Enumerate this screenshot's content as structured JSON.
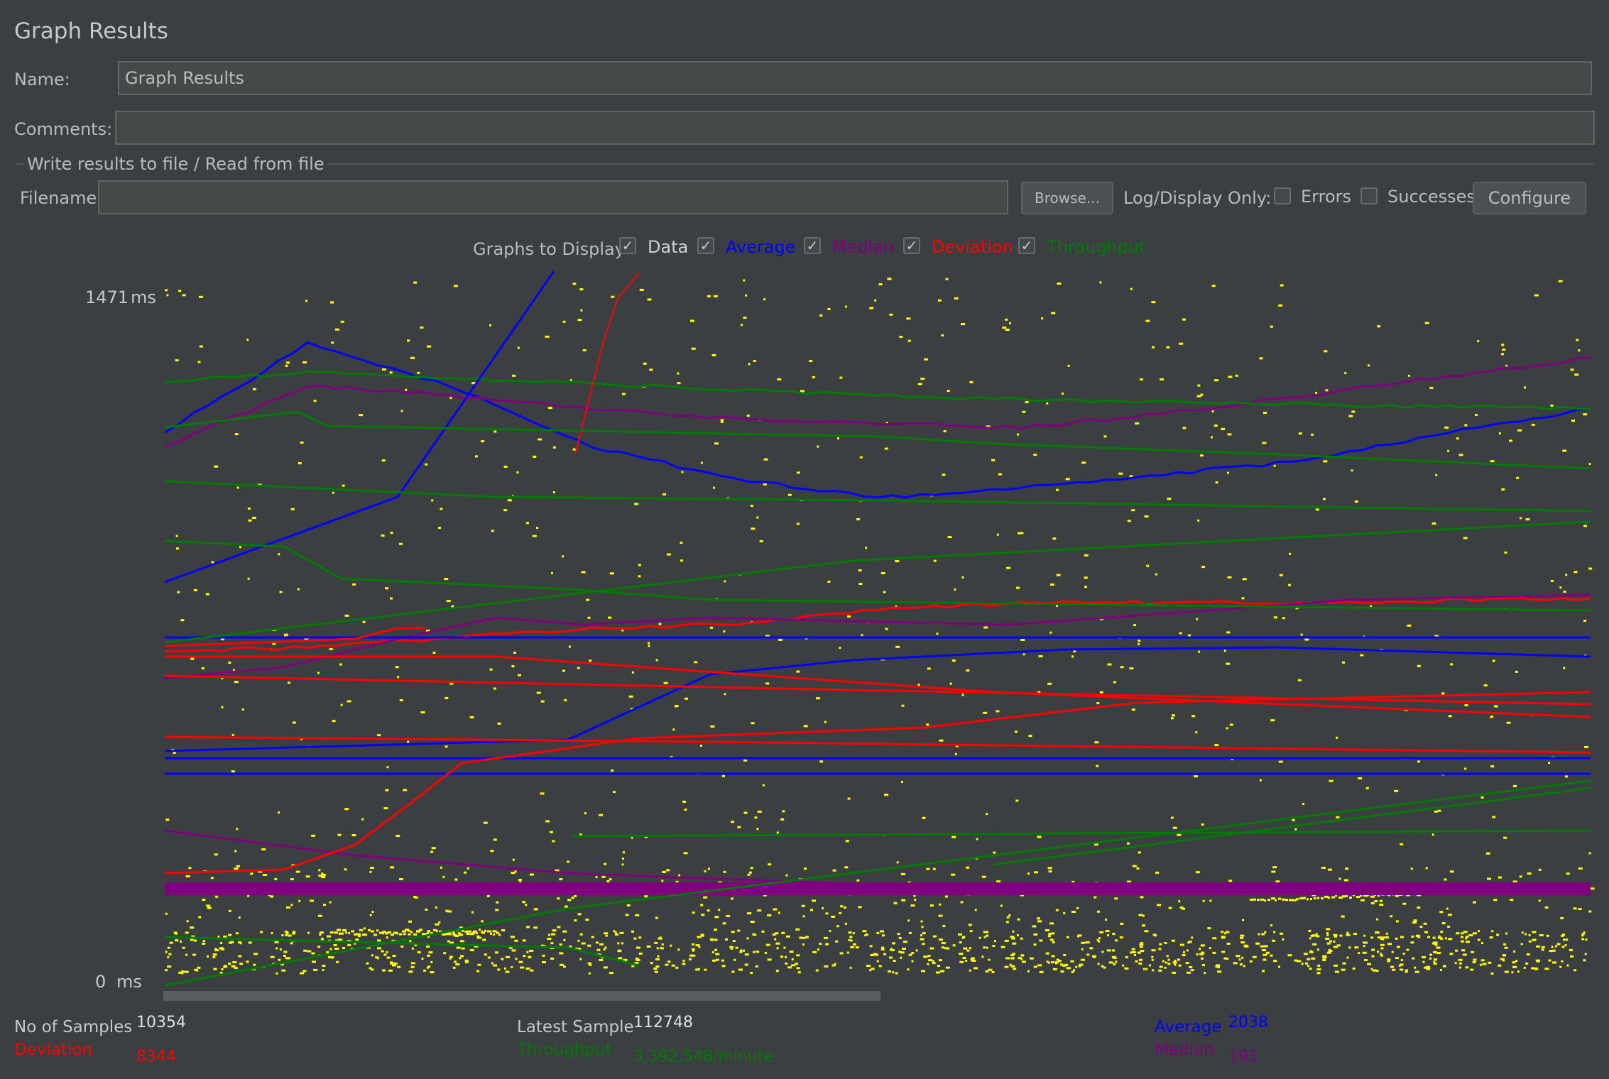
{
  "panel": {
    "title": "Graph Results",
    "name_label": "Name:",
    "name_value": "Graph Results",
    "comments_label": "Comments:",
    "comments_value": ""
  },
  "file_section": {
    "legend": "Write results to file / Read from file",
    "filename_label": "Filename",
    "filename_value": "",
    "browse_label": "Browse...",
    "log_display_label": "Log/Display Only:",
    "errors_label": "Errors",
    "errors_checked": false,
    "successes_label": "Successes",
    "successes_checked": false,
    "configure_label": "Configure"
  },
  "graphs_to_display": {
    "label": "Graphs to Display",
    "options": [
      {
        "label": "Data",
        "checked": true,
        "color": "#d0d0d0"
      },
      {
        "label": "Average",
        "checked": true,
        "color": "#0000ff"
      },
      {
        "label": "Median",
        "checked": true,
        "color": "#800080"
      },
      {
        "label": "Deviation",
        "checked": true,
        "color": "#ff0000"
      },
      {
        "label": "Throughput",
        "checked": true,
        "color": "#007a00"
      }
    ]
  },
  "graph": {
    "y_max_label": "1471",
    "y_min_label": "0",
    "unit": "ms"
  },
  "stats": {
    "samples_label": "No of Samples",
    "samples_value": "10354",
    "latest_label": "Latest Sample",
    "latest_value": "112748",
    "average_label": "Average",
    "average_value": "2038",
    "deviation_label": "Deviation",
    "deviation_value": "8344",
    "throughput_label": "Throughput",
    "throughput_value": "3,392,548/minute",
    "median_label": "Median",
    "median_value": "191"
  },
  "colors": {
    "data": "#ffff00",
    "average": "#0000ff",
    "median": "#800080",
    "deviation": "#ff0000",
    "throughput": "#007a00"
  },
  "chart_data": {
    "type": "line",
    "title": "",
    "ylim": [
      0,
      1471
    ],
    "ylabel": "ms",
    "x": [
      0,
      100,
      200,
      300,
      400,
      500,
      600,
      700,
      800,
      900,
      1000
    ],
    "series": [
      {
        "name": "Average",
        "values": [
          1180,
          1370,
          1280,
          1150,
          1080,
          1040,
          1060,
          1090,
          1120,
          1180,
          1230
        ]
      },
      {
        "name": "Median",
        "values": [
          1150,
          1280,
          1260,
          1230,
          1210,
          1200,
          1190,
          1220,
          1260,
          1300,
          1340
        ]
      },
      {
        "name": "Deviation",
        "values": [
          710,
          720,
          740,
          760,
          770,
          800,
          815,
          815,
          815,
          820,
          825
        ]
      },
      {
        "name": "Throughput",
        "values": [
          1290,
          1310,
          1295,
          1285,
          1270,
          1260,
          1250,
          1245,
          1240,
          1235,
          1230
        ]
      }
    ]
  }
}
